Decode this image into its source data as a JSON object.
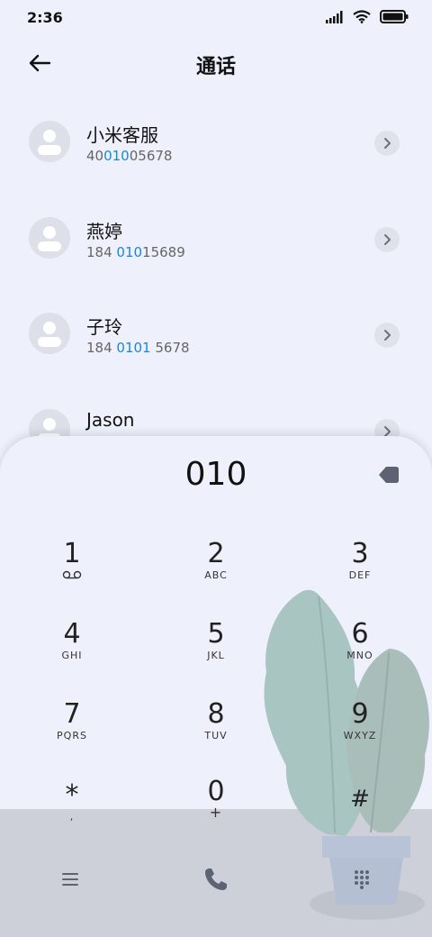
{
  "status_bar": {
    "time": "2:36"
  },
  "header": {
    "title": "通话"
  },
  "contacts": [
    {
      "name": "小米客服",
      "number_parts": [
        "40",
        "010",
        "05678"
      ]
    },
    {
      "name": "燕婷",
      "number_parts": [
        "184 ",
        "010",
        "15689"
      ]
    },
    {
      "name": "子玲",
      "number_parts": [
        "184 ",
        "0101",
        " 5678"
      ]
    },
    {
      "name": "Jason",
      "number_parts": [
        "",
        "",
        ""
      ]
    }
  ],
  "dialer": {
    "entered_number": "010",
    "keys": [
      {
        "digit": "1",
        "letters": ""
      },
      {
        "digit": "2",
        "letters": "ABC"
      },
      {
        "digit": "3",
        "letters": "DEF"
      },
      {
        "digit": "4",
        "letters": "GHI"
      },
      {
        "digit": "5",
        "letters": "JKL"
      },
      {
        "digit": "6",
        "letters": "MNO"
      },
      {
        "digit": "7",
        "letters": "PQRS"
      },
      {
        "digit": "8",
        "letters": "TUV"
      },
      {
        "digit": "9",
        "letters": "WXYZ"
      },
      {
        "digit": "*",
        "letters": ","
      },
      {
        "digit": "0",
        "letters": "+"
      },
      {
        "digit": "#",
        "letters": ""
      }
    ]
  },
  "icons": {
    "back": "back-arrow-icon",
    "chevron": "chevron-right-icon",
    "backspace": "backspace-icon",
    "voicemail": "voicemail-icon",
    "menu": "menu-icon",
    "call": "phone-icon",
    "dialpad": "dialpad-icon"
  },
  "colors": {
    "background": "#eef1fb",
    "highlight": "#1a87d6",
    "bottom_band": "#cdd0d9",
    "icon_gray": "#5d6372"
  }
}
